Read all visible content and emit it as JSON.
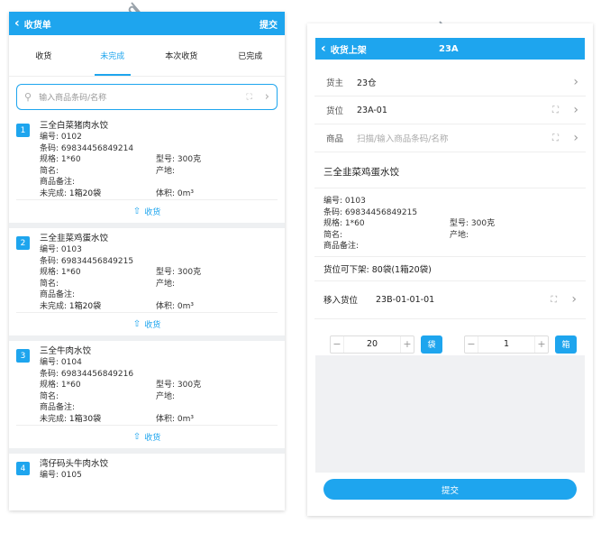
{
  "left": {
    "header": {
      "title": "收货单",
      "submit": "提交"
    },
    "tabs": [
      {
        "label": "收货"
      },
      {
        "label": "未完成"
      },
      {
        "label": "本次收货"
      },
      {
        "label": "已完成"
      }
    ],
    "search": {
      "placeholder": "输入商品条码/名称"
    },
    "receive_label": "收货",
    "items": [
      {
        "num": "1",
        "name": "三全白菜猪肉水饺",
        "code_label": "编号:",
        "code": "0102",
        "barcode_label": "条码:",
        "barcode": "6983445684921​4",
        "spec_label": "规格:",
        "spec": "1*60",
        "model_label": "型号:",
        "model": "300克",
        "abbr_label": "简名:",
        "origin_label": "产地:",
        "note_label": "商品备注:",
        "unfinished_label": "未完成:",
        "unfinished": "1箱20袋",
        "volume_label": "体积:",
        "volume": "0m³"
      },
      {
        "num": "2",
        "name": "三全韭菜鸡蛋水饺",
        "code_label": "编号:",
        "code": "0103",
        "barcode_label": "条码:",
        "barcode": "69834456849215",
        "spec_label": "规格:",
        "spec": "1*60",
        "model_label": "型号:",
        "model": "300克",
        "abbr_label": "简名:",
        "origin_label": "产地:",
        "note_label": "商品备注:",
        "unfinished_label": "未完成:",
        "unfinished": "1箱20袋",
        "volume_label": "体积:",
        "volume": "0m³"
      },
      {
        "num": "3",
        "name": "三全牛肉水饺",
        "code_label": "编号:",
        "code": "0104",
        "barcode_label": "条码:",
        "barcode": "69834456849216",
        "spec_label": "规格:",
        "spec": "1*60",
        "model_label": "型号:",
        "model": "300克",
        "abbr_label": "简名:",
        "origin_label": "产地:",
        "note_label": "商品备注:",
        "unfinished_label": "未完成:",
        "unfinished": "1箱30袋",
        "volume_label": "体积:",
        "volume": "0m³"
      },
      {
        "num": "4",
        "name": "湾仔码头牛肉水饺",
        "code_label": "编号:",
        "code": "0105"
      }
    ]
  },
  "right": {
    "header": {
      "title": "收货上架",
      "code": "23A"
    },
    "owner": {
      "label": "货主",
      "value": "23仓"
    },
    "location": {
      "label": "货位",
      "value": "23A-01"
    },
    "product": {
      "label": "商品",
      "placeholder": "扫描/输入商品条码/名称"
    },
    "product_name": "三全韭菜鸡蛋水饺",
    "detail": {
      "code_label": "编号:",
      "code": "0103",
      "barcode_label": "条码:",
      "barcode": "69834456849215",
      "spec_label": "规格:",
      "spec": "1*60",
      "model_label": "型号:",
      "model": "300克",
      "abbr_label": "简名:",
      "origin_label": "产地:",
      "note_label": "商品备注:"
    },
    "available_label": "货位可下架:",
    "available": "80袋(1箱20袋)",
    "target_label": "移入货位",
    "target": "23B-01-01-01",
    "bag_qty": "20",
    "bag_unit": "袋",
    "box_qty": "1",
    "box_unit": "箱",
    "submit": "提交"
  }
}
